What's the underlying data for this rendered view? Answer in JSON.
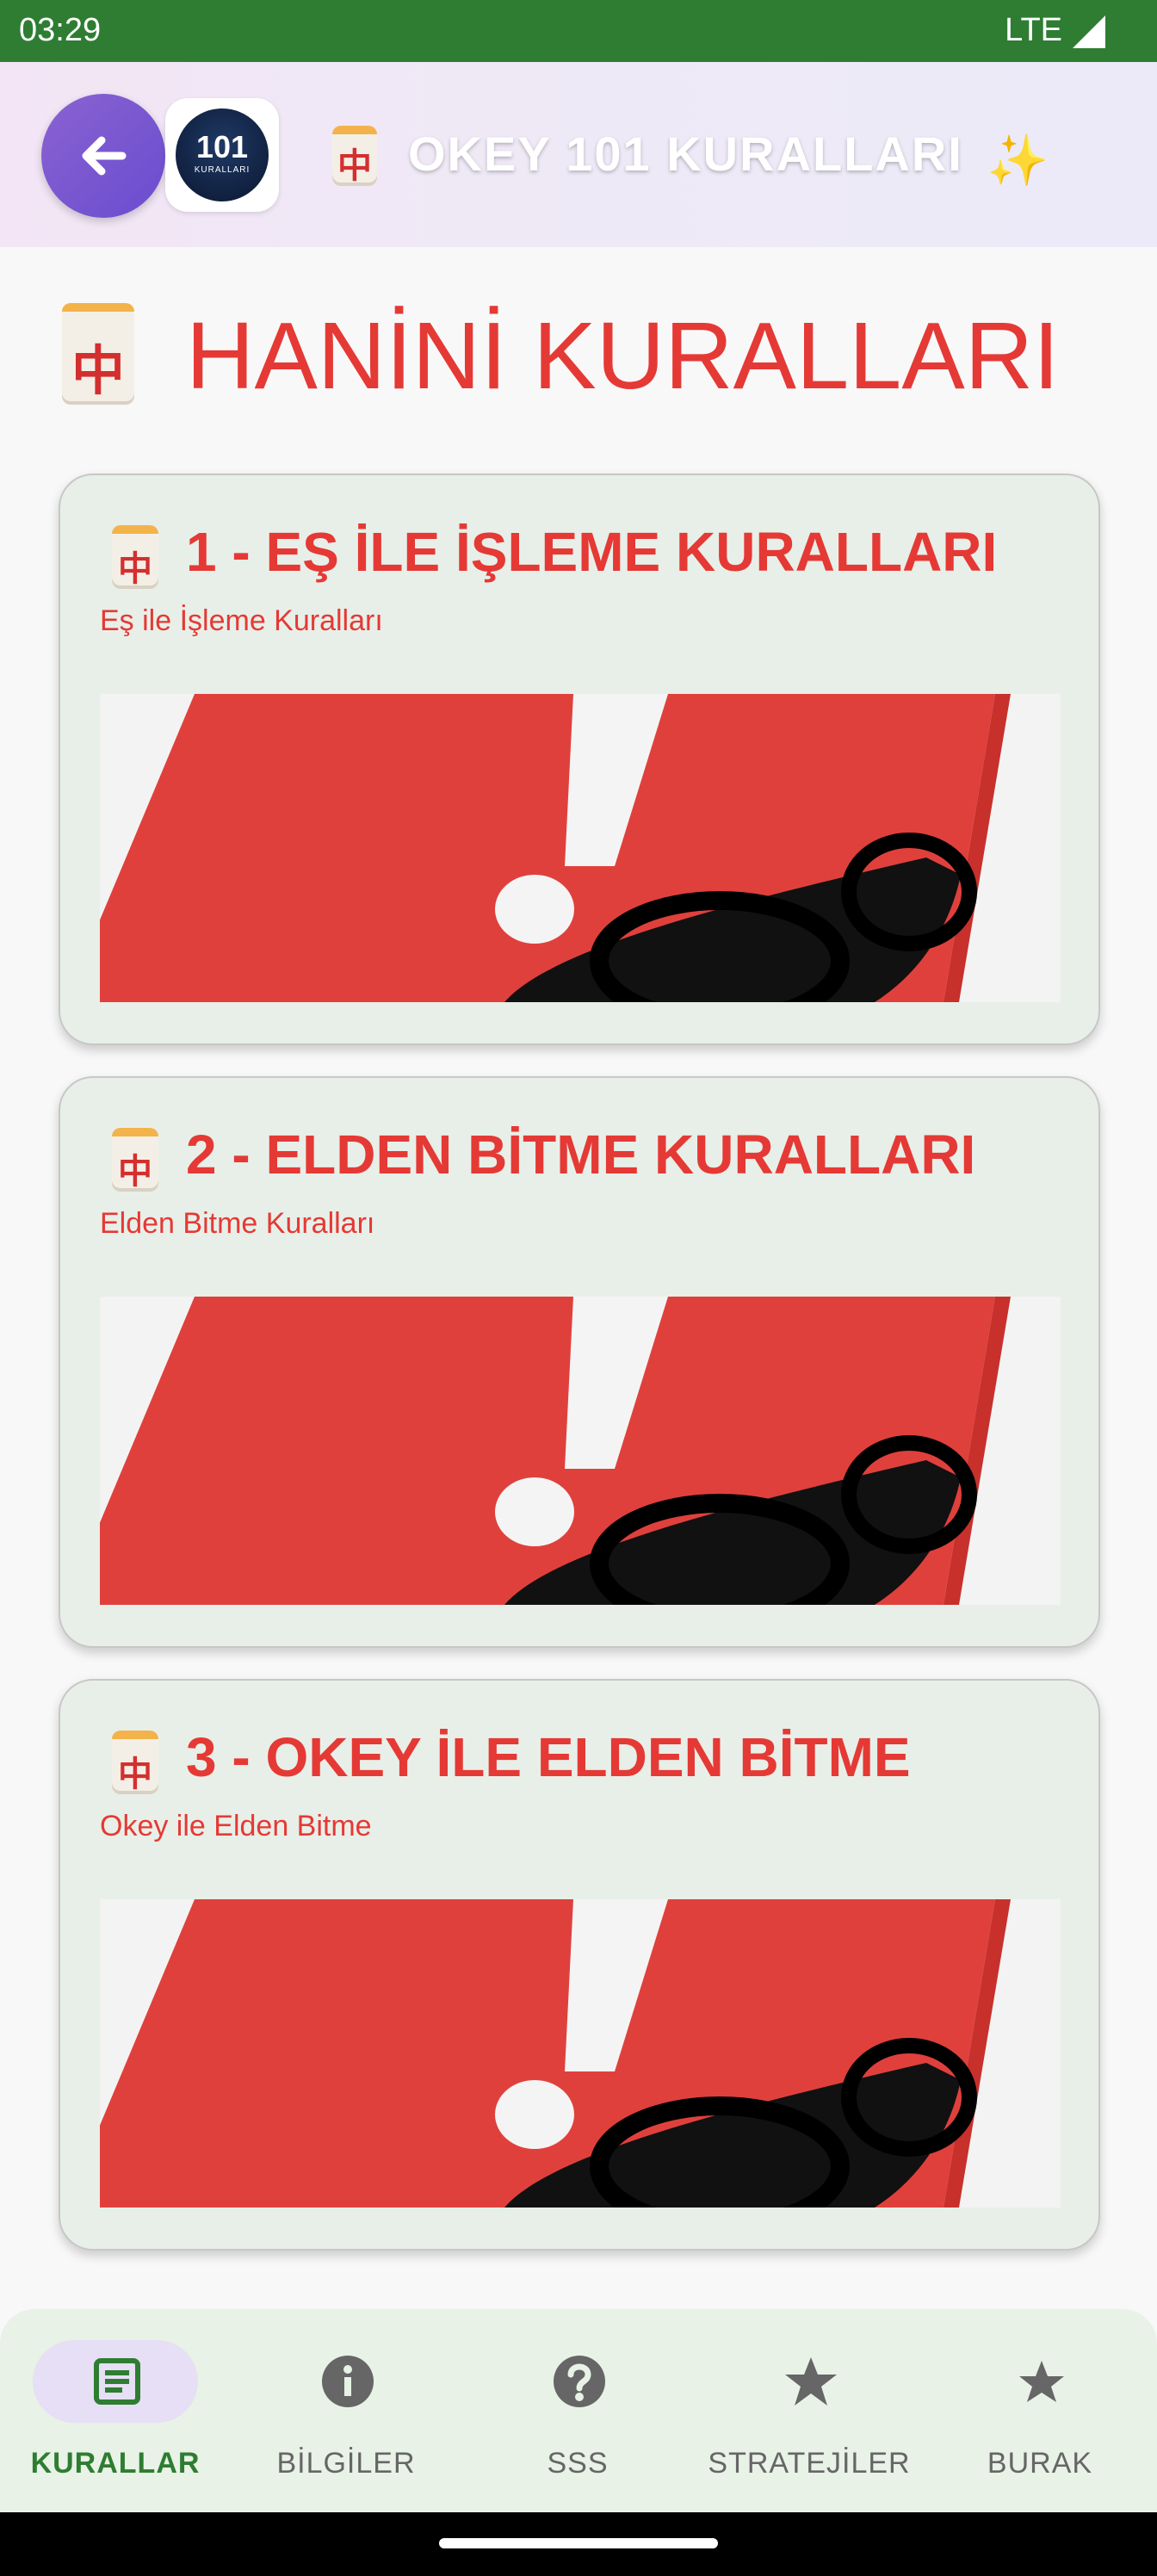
{
  "status_bar": {
    "time": "03:29",
    "network": "LTE"
  },
  "header": {
    "logo_number": "101",
    "logo_text": "KURALLARI",
    "title": "OKEY 101 KURALLARI",
    "tile_glyph": "中",
    "sparkle": "✨"
  },
  "page": {
    "title": "HANİNİ KURALLARI",
    "tile_glyph": "中"
  },
  "cards": [
    {
      "title": "1 - EŞ İLE İŞLEME KURALLARI",
      "subtitle": "Eş ile İşleme Kuralları",
      "tile_glyph": "中",
      "image_icon": "exclamation-book-glasses"
    },
    {
      "title": "2 - ELDEN BİTME KURALLARI",
      "subtitle": "Elden Bitme Kuralları",
      "tile_glyph": "中",
      "image_icon": "exclamation-book-glasses"
    },
    {
      "title": "3 - OKEY İLE ELDEN BİTME",
      "subtitle": "Okey ile Elden Bitme",
      "tile_glyph": "中",
      "image_icon": "exclamation-book-glasses"
    }
  ],
  "bottom_nav": [
    {
      "label": "KURALLAR",
      "icon": "list-icon",
      "active": true
    },
    {
      "label": "BİLGİLER",
      "icon": "info-icon",
      "active": false
    },
    {
      "label": "SSS",
      "icon": "help-icon",
      "active": false
    },
    {
      "label": "STRATEJİLER",
      "icon": "star-icon",
      "active": false
    },
    {
      "label": "BURAK",
      "icon": "star-icon",
      "active": false
    }
  ],
  "colors": {
    "primary_red": "#e53935",
    "status_green": "#2e7d32",
    "card_bg": "#e8efe8"
  }
}
